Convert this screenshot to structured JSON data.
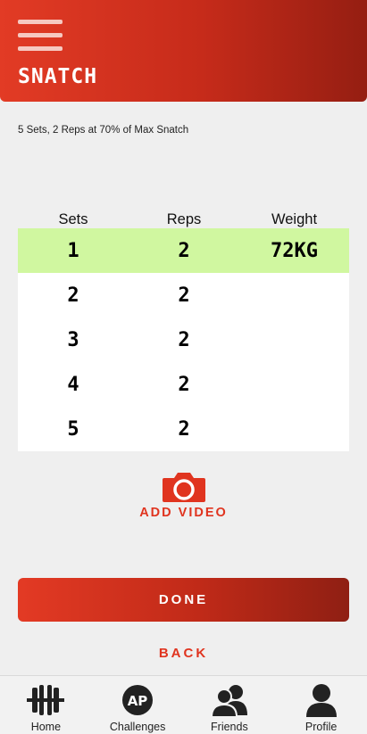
{
  "header": {
    "title": "SNATCH"
  },
  "workout": {
    "description": "5 Sets, 2 Reps at 70% of Max Snatch"
  },
  "table": {
    "headers": {
      "sets": "Sets",
      "reps": "Reps",
      "weight": "Weight"
    },
    "rows": [
      {
        "set": "1",
        "reps": "2",
        "weight": "72KG"
      },
      {
        "set": "2",
        "reps": "2",
        "weight": ""
      },
      {
        "set": "3",
        "reps": "2",
        "weight": ""
      },
      {
        "set": "4",
        "reps": "2",
        "weight": ""
      },
      {
        "set": "5",
        "reps": "2",
        "weight": ""
      }
    ],
    "active_row_color": "#d0f7a0"
  },
  "actions": {
    "add_video": "ADD VIDEO",
    "done": "DONE",
    "back": "BACK"
  },
  "nav": {
    "items": [
      {
        "label": "Home",
        "icon": "barbell-icon"
      },
      {
        "label": "Challenges",
        "icon": "ap-badge-icon"
      },
      {
        "label": "Friends",
        "icon": "friends-icon"
      },
      {
        "label": "Profile",
        "icon": "profile-icon"
      }
    ],
    "icon_text": "AP"
  },
  "colors": {
    "brand_red": "#e0341f",
    "brand_dark_red": "#951e12",
    "background": "#efefef"
  }
}
